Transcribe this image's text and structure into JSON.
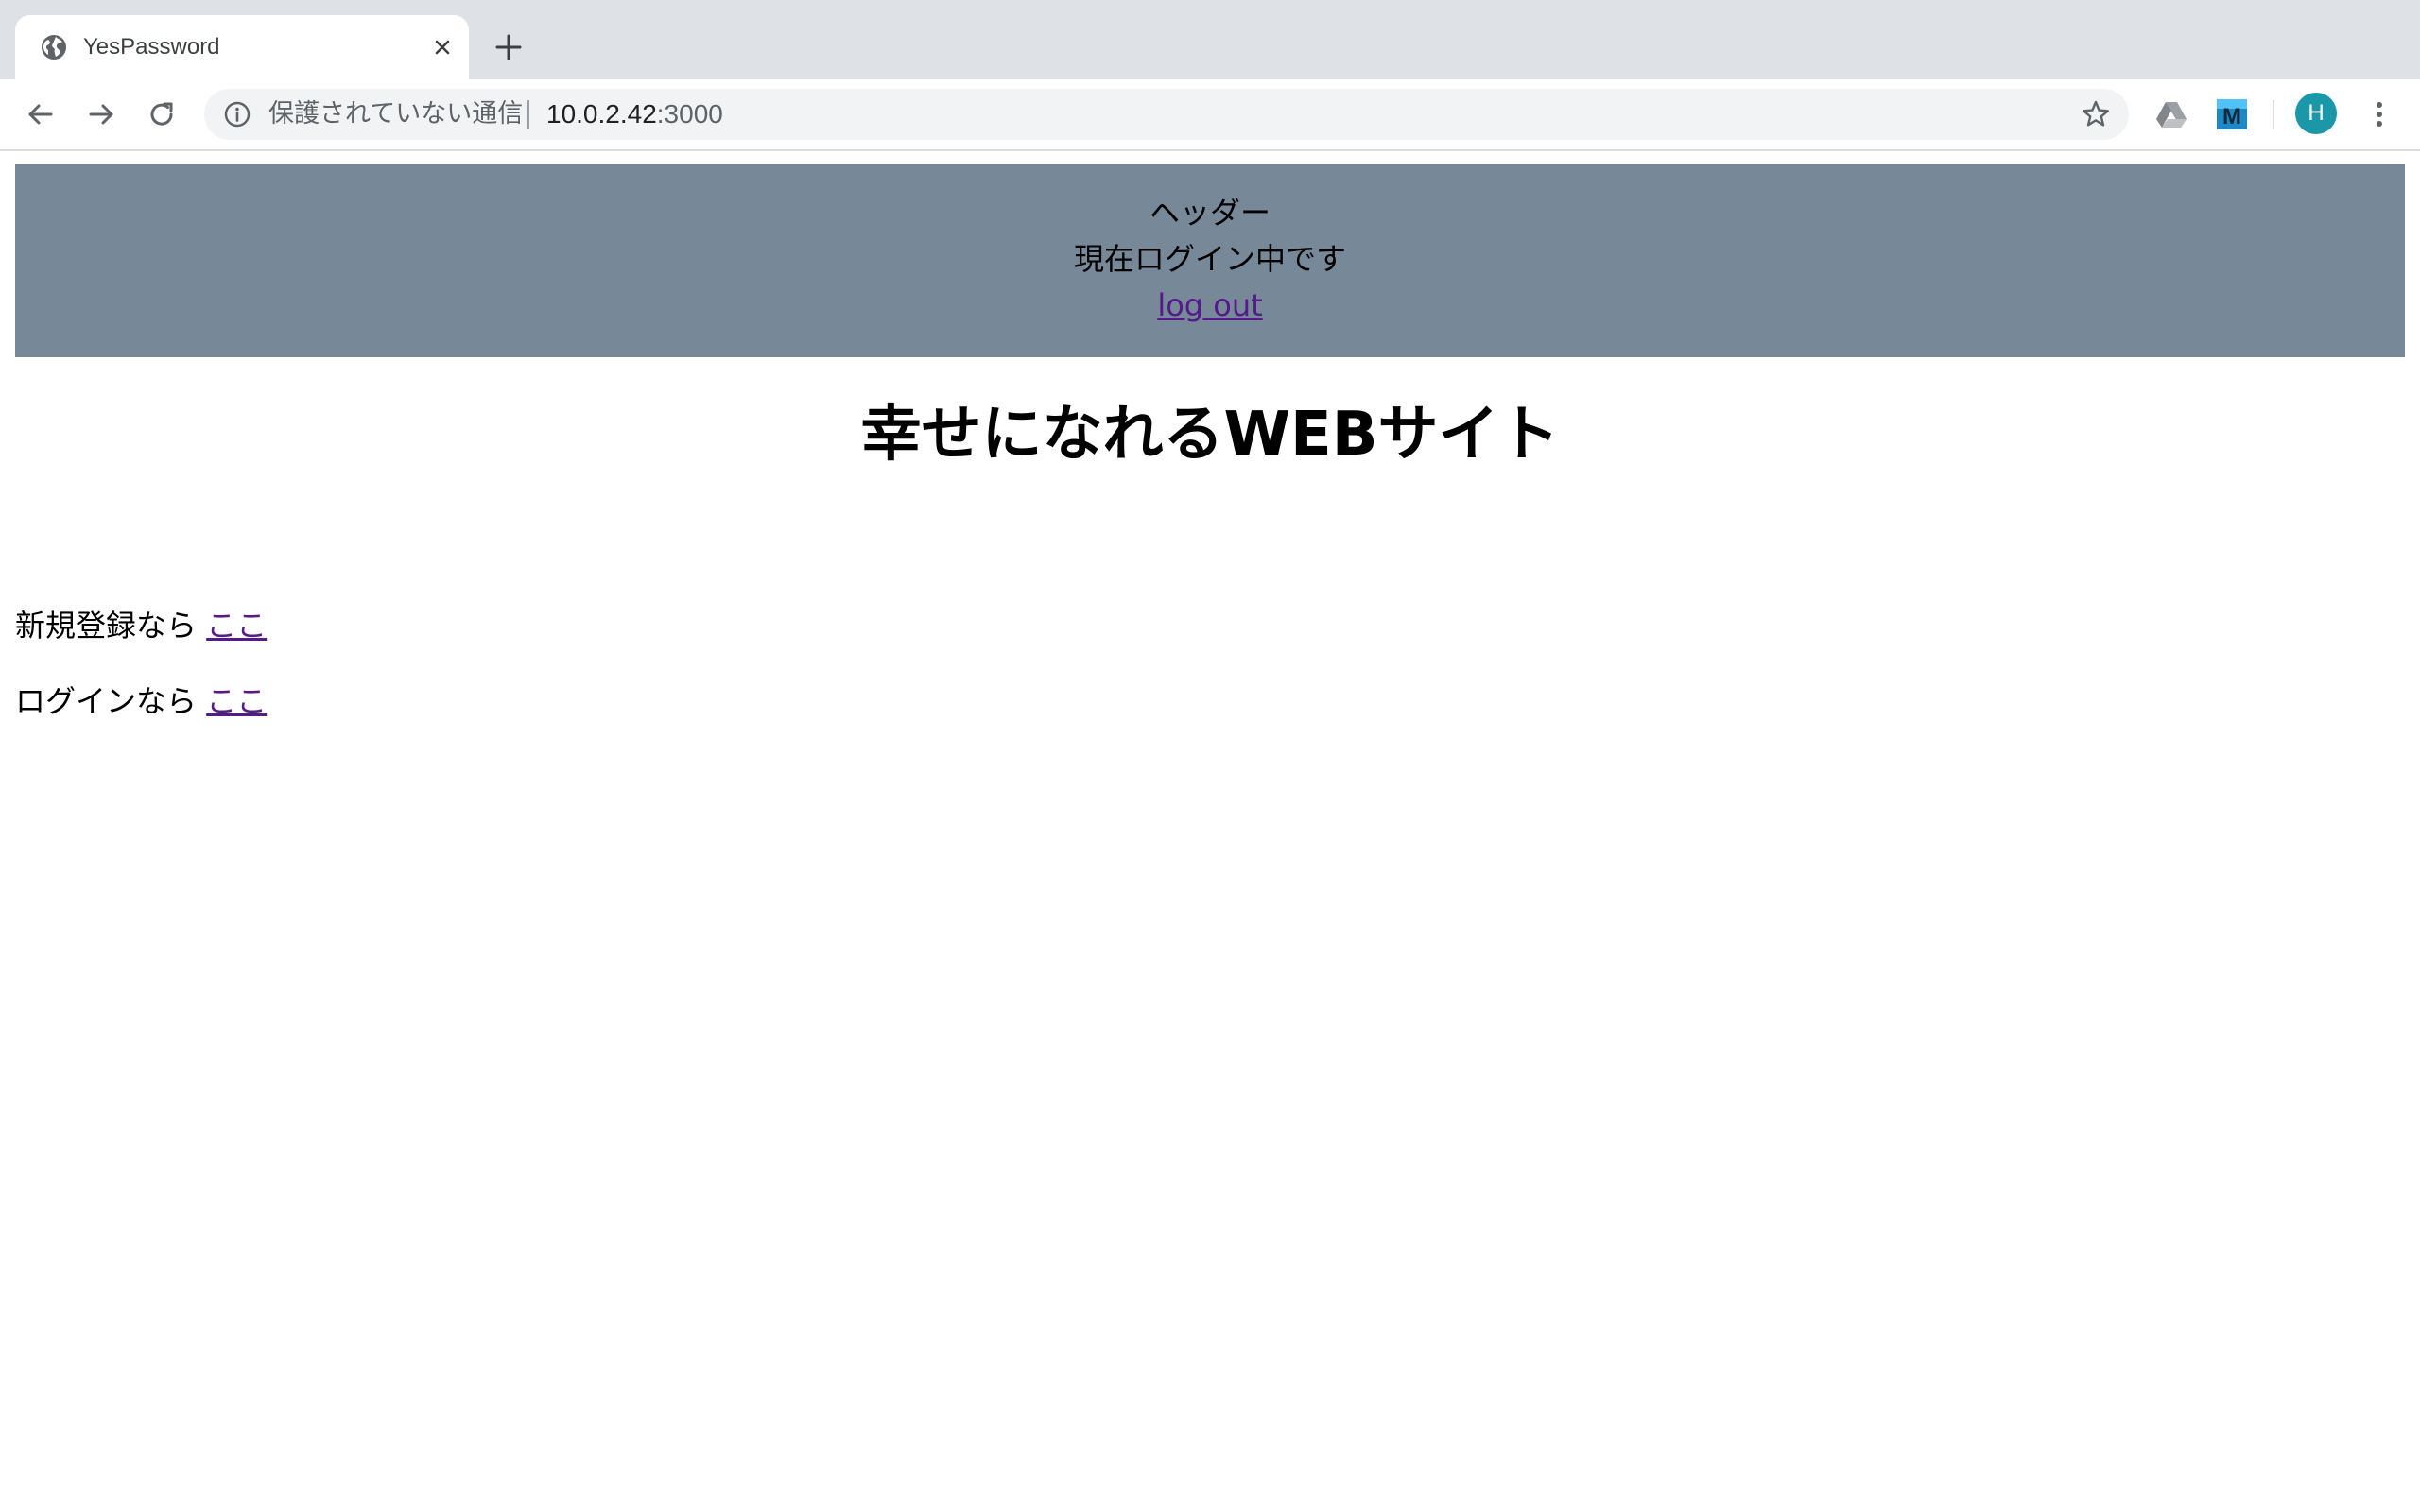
{
  "browser": {
    "tab": {
      "title": "YesPassword",
      "favicon": "globe-icon"
    },
    "toolbar": {
      "security_label": "保護されていない通信",
      "url_host": "10.0.2.42",
      "url_port": ":3000",
      "extension_label": "M",
      "avatar_initial": "H"
    },
    "colors": {
      "tabbar_bg": "#dee1e6",
      "omnibox_bg": "#f1f3f4",
      "avatar_bg": "#1a97a8"
    }
  },
  "page": {
    "header": {
      "title": "ヘッダー",
      "status": "現在ログイン中です",
      "logout_link": "log out",
      "background": "#778899"
    },
    "main_title": "幸せになれるWEBサイト",
    "signup": {
      "prefix": "新規登録なら",
      "link": "ここ"
    },
    "login": {
      "prefix": "ログインなら",
      "link": "ここ"
    },
    "link_color": "#551a8b"
  }
}
